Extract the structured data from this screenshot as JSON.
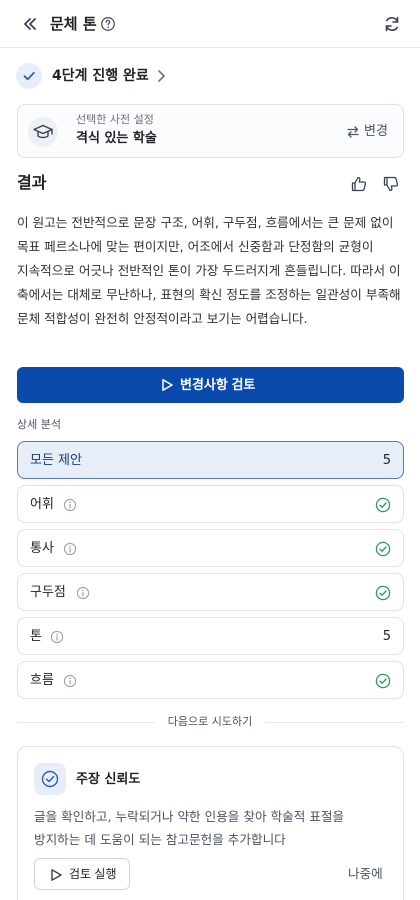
{
  "header": {
    "title": "문체 톤",
    "icons": {
      "collapse": "double-chevron-left-icon",
      "help": "question-circle-icon",
      "refresh": "refresh-icon"
    }
  },
  "progress": {
    "step_label": "4단계 진행 완료"
  },
  "preset": {
    "subtitle": "선택한 사전 설정",
    "name": "격식 있는 학술",
    "change_label": "변경"
  },
  "result": {
    "title": "결과",
    "body": "이 원고는 전반적으로 문장 구조, 어휘, 구두점, 흐름에서는 큰 문제 없이 목표 페르소나에 맞는 편이지만, 어조에서 신중함과 단정함의 균형이 지속적으로 어긋나 전반적인 톤이 가장 두드러지게 흔들립니다. 따라서 이 축에서는 대체로 무난하나, 표현의 확신 정도를 조정하는 일관성이 부족해 문체 적합성이 완전히 안정적이라고 보기는 어렵습니다."
  },
  "review_button": {
    "label": "변경사항 검토"
  },
  "detail": {
    "section_label": "상세 분석",
    "categories": [
      {
        "name": "모든 제안",
        "count": "5",
        "selected": true
      },
      {
        "name": "어휘",
        "status": "ok"
      },
      {
        "name": "통사",
        "status": "ok"
      },
      {
        "name": "구두점",
        "status": "ok"
      },
      {
        "name": "톤",
        "count": "5"
      },
      {
        "name": "흐름",
        "status": "ok"
      }
    ]
  },
  "next": {
    "divider_label": "다음으로 시도하기",
    "card": {
      "title": "주장 신뢰도",
      "description": "글을 확인하고, 누락되거나 약한 인용을 찾아 학술적 표절을 방지하는 데 도움이 되는 참고문헌을 추가합니다",
      "run_label": "검토 실행",
      "later_label": "나중에"
    }
  },
  "colors": {
    "primary": "#0a4aad",
    "success": "#2e9b5a",
    "border": "#dfe3e8",
    "selected_bg": "#e8eef8"
  }
}
